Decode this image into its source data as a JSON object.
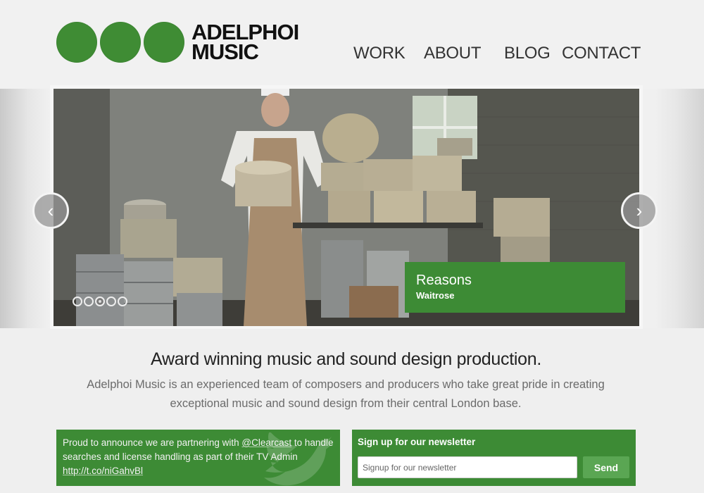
{
  "brand": {
    "line1": "ADELPHOI",
    "line2": "MUSIC",
    "accent": "#3f8c34"
  },
  "nav": {
    "work": "WORK",
    "about": "ABOUT",
    "blog": "BLOG",
    "contact": "CONTACT"
  },
  "slider": {
    "caption_title": "Reasons",
    "caption_client": "Waitrose",
    "prev_icon": "‹",
    "next_icon": "›",
    "slide_count": 5,
    "active_slide": 3
  },
  "intro": {
    "headline": "Award winning music and sound design production.",
    "body": "Adelphoi Music is an experienced team of composers and producers who take great pride in creating exceptional music and sound design from their central London base."
  },
  "tweet": {
    "text_before": "Proud to announce we are partnering with ",
    "mention": "@Clearcast",
    "text_after": " to handle searches and license handling as part of their TV Admin ",
    "link": "http://t.co/niGahvBl",
    "icon": "twitter-bird-icon"
  },
  "newsletter": {
    "title": "Sign up for our newsletter",
    "placeholder": "Signup for our newsletter",
    "send_label": "Send"
  }
}
